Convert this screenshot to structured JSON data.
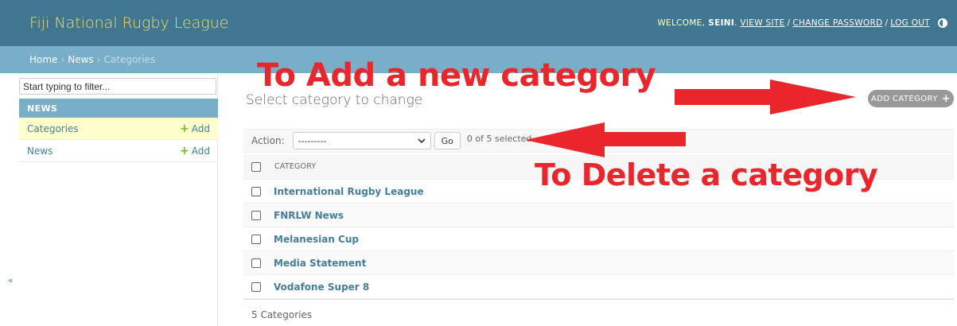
{
  "header": {
    "site_name": "Fiji National Rugby League",
    "welcome": "WELCOME,",
    "username": "SEINI",
    "view_site": "VIEW SITE",
    "change_password": "CHANGE PASSWORD",
    "log_out": "LOG OUT",
    "separator": "/",
    "theme_icon": "theme-toggle-icon"
  },
  "breadcrumbs": {
    "home": "Home",
    "app": "News",
    "current": "Categories",
    "separator": "›"
  },
  "sidebar": {
    "filter_placeholder": "Start typing to filter...",
    "app_caption": "NEWS",
    "add_label": "Add",
    "models": [
      {
        "name": "Categories",
        "add": "Add",
        "current": true
      },
      {
        "name": "News",
        "add": "Add",
        "current": false
      }
    ],
    "toggle_glyph": "«"
  },
  "main": {
    "title": "Select category to change",
    "add_button": "ADD CATEGORY",
    "actions": {
      "label": "Action:",
      "selected_option": "---------",
      "go": "Go",
      "selection_count": "0 of 5 selected"
    },
    "table": {
      "column": "CATEGORY",
      "rows": [
        "International Rugby League",
        "FNRLW News",
        "Melanesian Cup",
        "Media Statement",
        "Vodafone Super 8"
      ]
    },
    "paginator": "5 Categories"
  },
  "annotations": {
    "add_note": "To Add a new category",
    "delete_note": "To Delete a category",
    "color": "#e8262c"
  },
  "colors": {
    "header_bg": "#417690",
    "branding": "#f5dd5d",
    "breadcrumbs_bg": "#79aec8",
    "link": "#447e9b",
    "add_green": "#70bf2b",
    "current_row": "#ffffcc"
  }
}
